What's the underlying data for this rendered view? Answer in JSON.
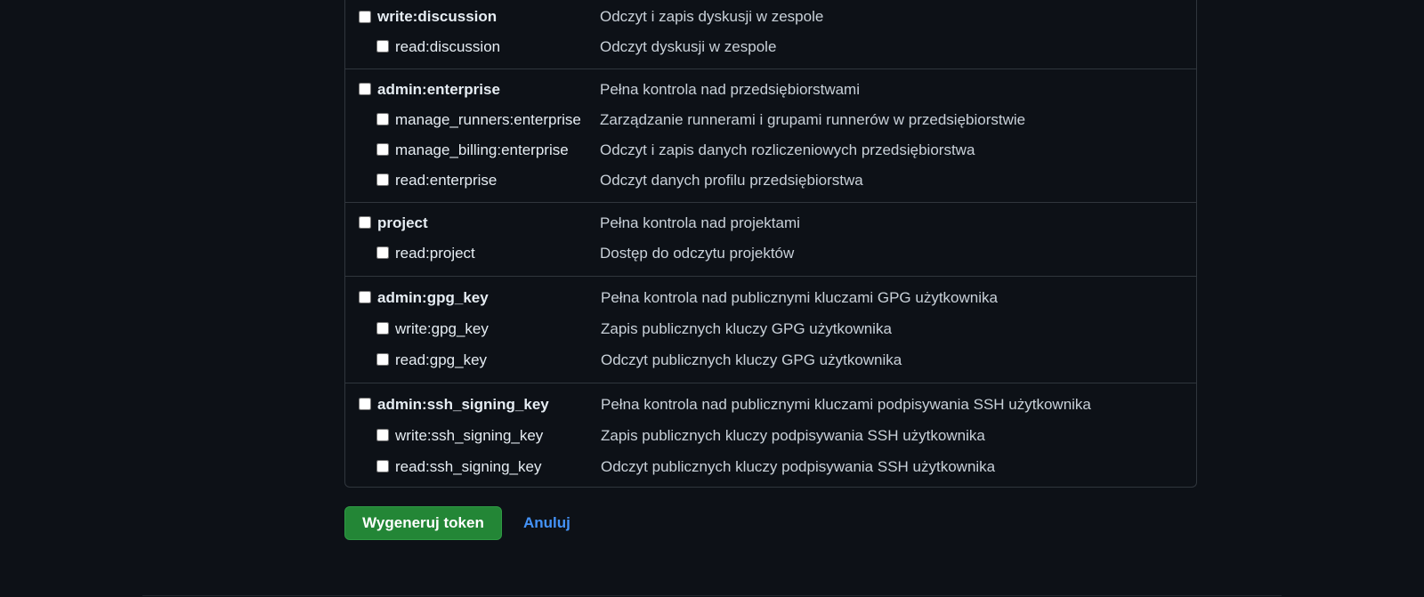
{
  "scopes": [
    {
      "parent": {
        "name": "write:discussion",
        "description": "Odczyt i zapis dyskusji w zespole"
      },
      "children": [
        {
          "name": "read:discussion",
          "description": "Odczyt dyskusji w zespole"
        }
      ]
    },
    {
      "parent": {
        "name": "admin:enterprise",
        "description": "Pełna kontrola nad przedsiębiorstwami"
      },
      "children": [
        {
          "name": "manage_runners:enterprise",
          "description": "Zarządzanie runnerami i grupami runnerów w przedsiębiorstwie"
        },
        {
          "name": "manage_billing:enterprise",
          "description": "Odczyt i zapis danych rozliczeniowych przedsiębiorstwa"
        },
        {
          "name": "read:enterprise",
          "description": "Odczyt danych profilu przedsiębiorstwa"
        }
      ]
    },
    {
      "parent": {
        "name": "project",
        "description": "Pełna kontrola nad projektami"
      },
      "children": [
        {
          "name": "read:project",
          "description": "Dostęp do odczytu projektów"
        }
      ]
    },
    {
      "parent": {
        "name": "admin:gpg_key",
        "description": "Pełna kontrola nad publicznymi kluczami GPG użytkownika"
      },
      "children": [
        {
          "name": "write:gpg_key",
          "description": "Zapis publicznych kluczy GPG użytkownika"
        },
        {
          "name": "read:gpg_key",
          "description": "Odczyt publicznych kluczy GPG użytkownika"
        }
      ]
    },
    {
      "parent": {
        "name": "admin:ssh_signing_key",
        "description": "Pełna kontrola nad publicznymi kluczami podpisywania SSH użytkownika"
      },
      "children": [
        {
          "name": "write:ssh_signing_key",
          "description": "Zapis publicznych kluczy podpisywania SSH użytkownika"
        },
        {
          "name": "read:ssh_signing_key",
          "description": "Odczyt publicznych kluczy podpisywania SSH użytkownika"
        }
      ]
    }
  ],
  "actions": {
    "generate_label": "Wygeneruj token",
    "cancel_label": "Anuluj"
  },
  "colors": {
    "background": "#0d1117",
    "primary_button": "#238636",
    "link": "#4493f8"
  }
}
